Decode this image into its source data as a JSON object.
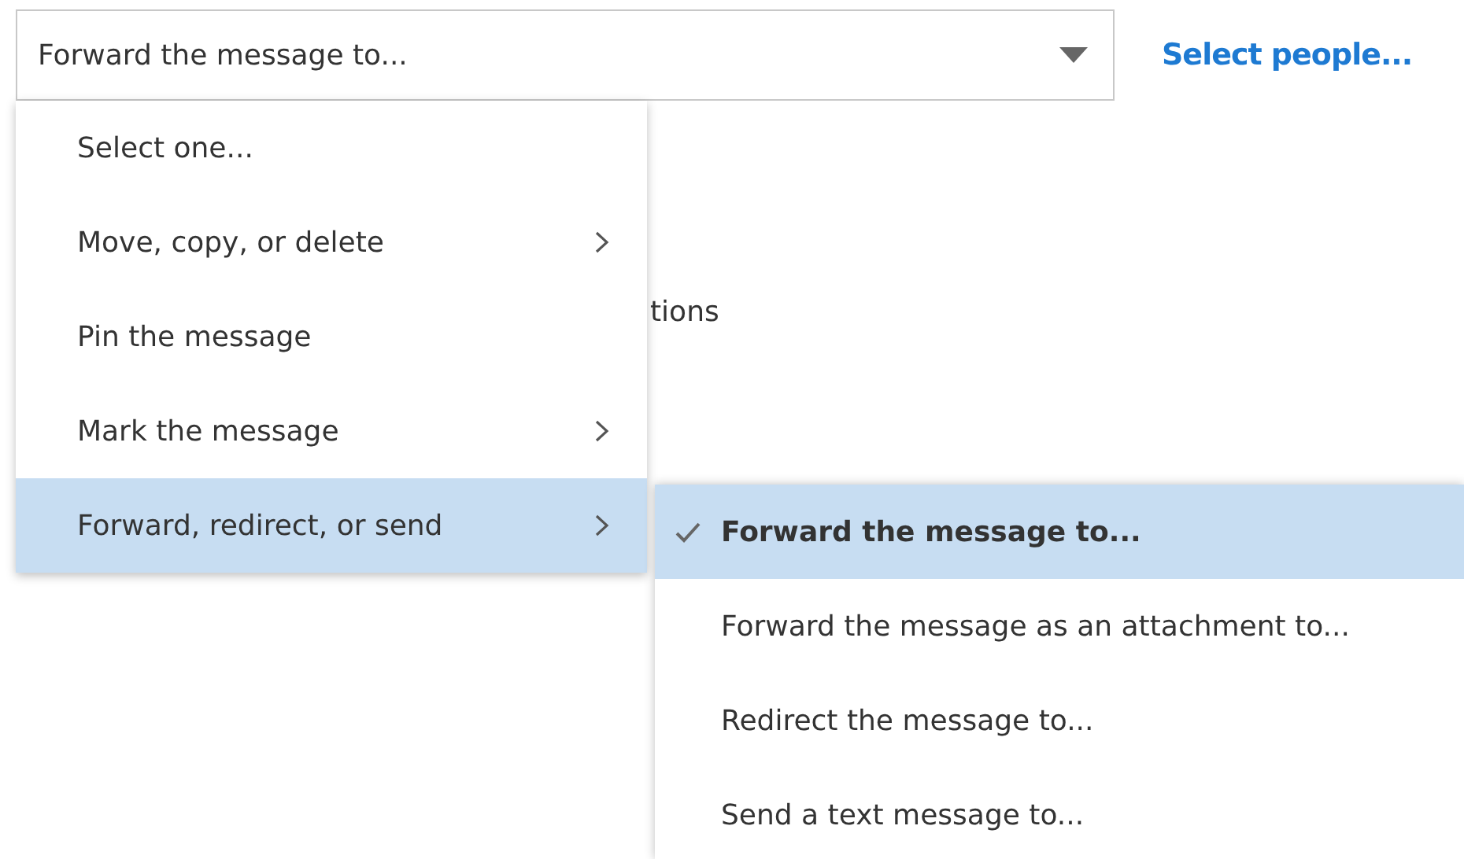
{
  "action_field": {
    "value": "Forward the message to..."
  },
  "select_link": "Select people...",
  "background_text": "tions",
  "menu": [
    {
      "label": "Select one...",
      "has_submenu": false,
      "selected": false
    },
    {
      "label": "Move, copy, or delete",
      "has_submenu": true,
      "selected": false
    },
    {
      "label": "Pin the message",
      "has_submenu": false,
      "selected": false
    },
    {
      "label": "Mark the message",
      "has_submenu": true,
      "selected": false
    },
    {
      "label": "Forward, redirect, or send",
      "has_submenu": true,
      "selected": true
    }
  ],
  "submenu": [
    {
      "label": "Forward the message to...",
      "selected": true
    },
    {
      "label": "Forward the message as an attachment to...",
      "selected": false
    },
    {
      "label": "Redirect the message to...",
      "selected": false
    },
    {
      "label": "Send a text message to...",
      "selected": false
    }
  ]
}
